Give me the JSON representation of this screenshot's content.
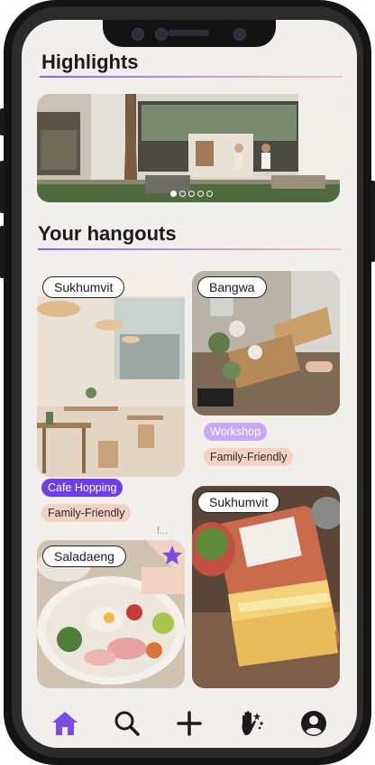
{
  "highlights": {
    "title": "Highlights",
    "carousel": {
      "total": 5,
      "active": 0
    }
  },
  "hangouts": {
    "title": "Your hangouts",
    "cards": [
      {
        "location": "Sukhumvit",
        "tags": [
          "Cafe Hopping",
          "Family-Friendly"
        ],
        "truncated": "f..."
      },
      {
        "location": "Bangwa",
        "tags": [
          "Workshop",
          "Family-Friendly"
        ]
      },
      {
        "location": "Saladaeng",
        "starred": true
      },
      {
        "location": "Sukhumvit"
      }
    ]
  },
  "tabs": [
    {
      "name": "home",
      "icon": "home-icon",
      "active": true
    },
    {
      "name": "search",
      "icon": "search-icon",
      "active": false
    },
    {
      "name": "add",
      "icon": "plus-icon",
      "active": false
    },
    {
      "name": "hangouts",
      "icon": "raised-hand-icon",
      "active": false
    },
    {
      "name": "profile",
      "icon": "profile-icon",
      "active": false
    }
  ],
  "colors": {
    "accent": "#6d3fe6",
    "tag_lavender": "#c8a7f5",
    "tag_peach": "#f3d1c4",
    "background": "#f1efec"
  }
}
